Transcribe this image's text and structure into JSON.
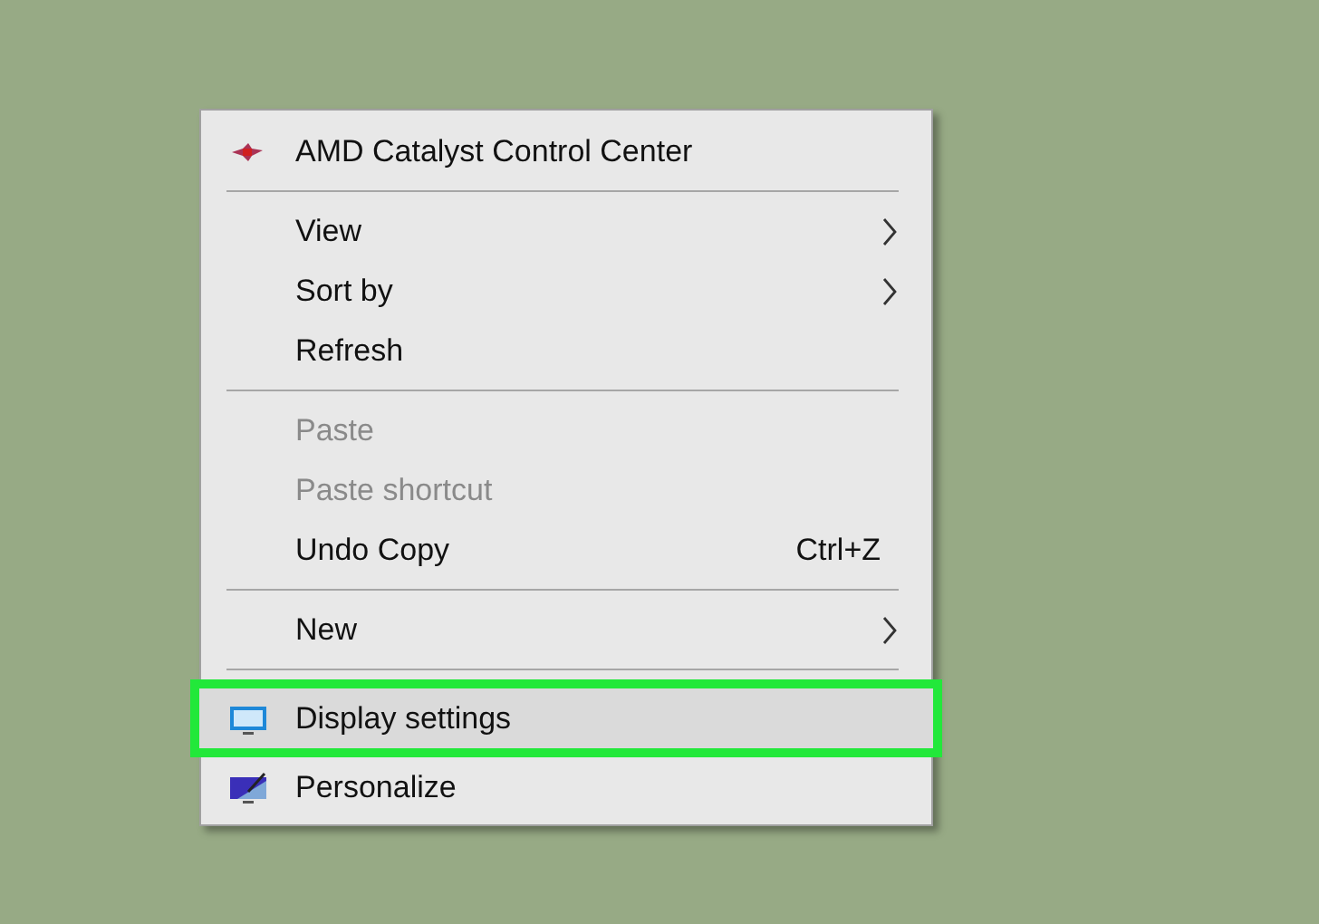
{
  "menu": {
    "items": [
      {
        "kind": "catalyst",
        "label": "AMD Catalyst Control Center",
        "disabled": false,
        "submenu": false,
        "selected": false
      },
      {
        "kind": "separator"
      },
      {
        "kind": "plain",
        "label": "View",
        "disabled": false,
        "submenu": true,
        "selected": false
      },
      {
        "kind": "plain",
        "label": "Sort by",
        "disabled": false,
        "submenu": true,
        "selected": false
      },
      {
        "kind": "plain",
        "label": "Refresh",
        "disabled": false,
        "submenu": false,
        "selected": false
      },
      {
        "kind": "separator"
      },
      {
        "kind": "plain",
        "label": "Paste",
        "disabled": true,
        "submenu": false,
        "selected": false
      },
      {
        "kind": "plain",
        "label": "Paste shortcut",
        "disabled": true,
        "submenu": false,
        "selected": false
      },
      {
        "kind": "plain",
        "label": "Undo Copy",
        "shortcut": "Ctrl+Z",
        "disabled": false,
        "submenu": false,
        "selected": false
      },
      {
        "kind": "separator"
      },
      {
        "kind": "plain",
        "label": "New",
        "disabled": false,
        "submenu": true,
        "selected": false
      },
      {
        "kind": "separator"
      },
      {
        "kind": "display",
        "label": "Display settings",
        "disabled": false,
        "submenu": false,
        "selected": true
      },
      {
        "kind": "personalize",
        "label": "Personalize",
        "disabled": false,
        "submenu": false,
        "selected": false
      }
    ]
  }
}
